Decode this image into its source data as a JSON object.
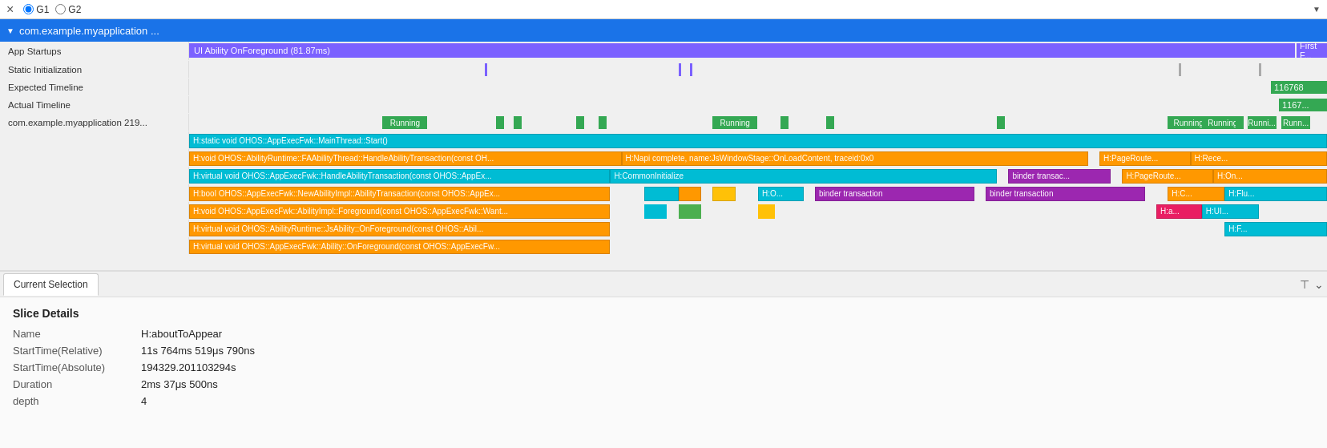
{
  "topbar": {
    "collapse_icon": "×",
    "g1_label": "G1",
    "g2_label": "G2",
    "dropdown_arrow": "▼"
  },
  "process": {
    "title": "com.example.myapplication ...",
    "collapse_arrow": "▼"
  },
  "tracks": [
    {
      "label": "App Startups",
      "bar_text": "UI Ability OnForeground (81.87ms)",
      "bar_end_text": "First F..."
    },
    {
      "label": "Static Initialization"
    },
    {
      "label": "Expected Timeline",
      "value": "116768"
    },
    {
      "label": "Actual Timeline",
      "value": "1167..."
    },
    {
      "label": "com.example.myapplication 219..."
    }
  ],
  "threads": [
    {
      "bar_text": "H:static void OHOS::AppExecFwk::MainThread::Start()"
    },
    {
      "label_text": "",
      "bars": [
        {
          "text": "H:void OHOS::AbilityRuntime::FAAbilityThread::HandleAbilityTransaction(const OH...",
          "color": "orange",
          "left": "0%",
          "width": "40%"
        },
        {
          "text": "H:Napi complete, name:JsWindowStage::OnLoadContent, traceid:0x0",
          "color": "orange",
          "left": "40%",
          "width": "42%"
        },
        {
          "text": "H:PageRoute...",
          "color": "orange",
          "left": "82%",
          "width": "8%"
        },
        {
          "text": "H:Rece...",
          "color": "orange",
          "left": "90%",
          "width": "10%"
        }
      ]
    },
    {
      "bars": [
        {
          "text": "H:virtual void OHOS::AppExecFwk::HandleAbilityTransaction(const OHOS::AppEx...",
          "color": "teal",
          "left": "0%",
          "width": "39%"
        },
        {
          "text": "H:CommonInitialize",
          "color": "teal",
          "left": "39%",
          "width": "35%"
        },
        {
          "text": "binder transac...",
          "color": "purple",
          "left": "74%",
          "width": "10%"
        },
        {
          "text": "H:PageRoute...",
          "color": "orange",
          "left": "84%",
          "width": "8%"
        },
        {
          "text": "H:On...",
          "color": "orange",
          "left": "92%",
          "width": "8%"
        }
      ]
    },
    {
      "bars": [
        {
          "text": "H:bool OHOS::AppExecFwk::NewAbilityImpl::AbilityTransaction(const OHOS::AppEx...",
          "color": "orange",
          "left": "0%",
          "width": "39%"
        },
        {
          "text": "H:O...",
          "color": "teal",
          "left": "47%",
          "width": "5%"
        },
        {
          "text": "binder transaction",
          "color": "purple",
          "left": "56%",
          "width": "15%"
        },
        {
          "text": "binder transaction",
          "color": "purple",
          "left": "72%",
          "width": "15%"
        },
        {
          "text": "H:C...",
          "color": "orange",
          "left": "88%",
          "width": "5%"
        },
        {
          "text": "H:Flu...",
          "color": "teal",
          "left": "93%",
          "width": "7%"
        }
      ]
    },
    {
      "bars": [
        {
          "text": "H:void OHOS::AppExecFwk::AbilityImpl::Foreground(const OHOS::AppExecFwk::Want...",
          "color": "orange",
          "left": "0%",
          "width": "38%"
        },
        {
          "text": "H:a...",
          "color": "pink",
          "left": "88%",
          "width": "4%"
        },
        {
          "text": "H:UI...",
          "color": "teal",
          "left": "92%",
          "width": "8%"
        }
      ]
    },
    {
      "bars": [
        {
          "text": "H:virtual void OHOS::AbilityRuntime::JsAbility::OnForeground(const OHOS::Abil...",
          "color": "orange",
          "left": "0%",
          "width": "38%"
        },
        {
          "text": "H:F...",
          "color": "teal",
          "left": "93%",
          "width": "7%"
        }
      ]
    },
    {
      "bars": [
        {
          "text": "H:virtual void OHOS::AppExecFwk::Ability::OnForeground(const OHOS::AppExecFw...",
          "color": "orange",
          "left": "0%",
          "width": "38%"
        }
      ]
    }
  ],
  "bottom_panel": {
    "tab_label": "Current Selection",
    "filter_icon": "⊤",
    "expand_icon": "⌄",
    "section_title": "Slice Details",
    "fields": [
      {
        "label": "Name",
        "value": "H:aboutToAppear"
      },
      {
        "label": "StartTime(Relative)",
        "value": "11s 764ms 519μs 790ns"
      },
      {
        "label": "StartTime(Absolute)",
        "value": "194329.201103294s"
      },
      {
        "label": "Duration",
        "value": "2ms 37μs 500ns"
      },
      {
        "label": "depth",
        "value": "4"
      }
    ]
  }
}
